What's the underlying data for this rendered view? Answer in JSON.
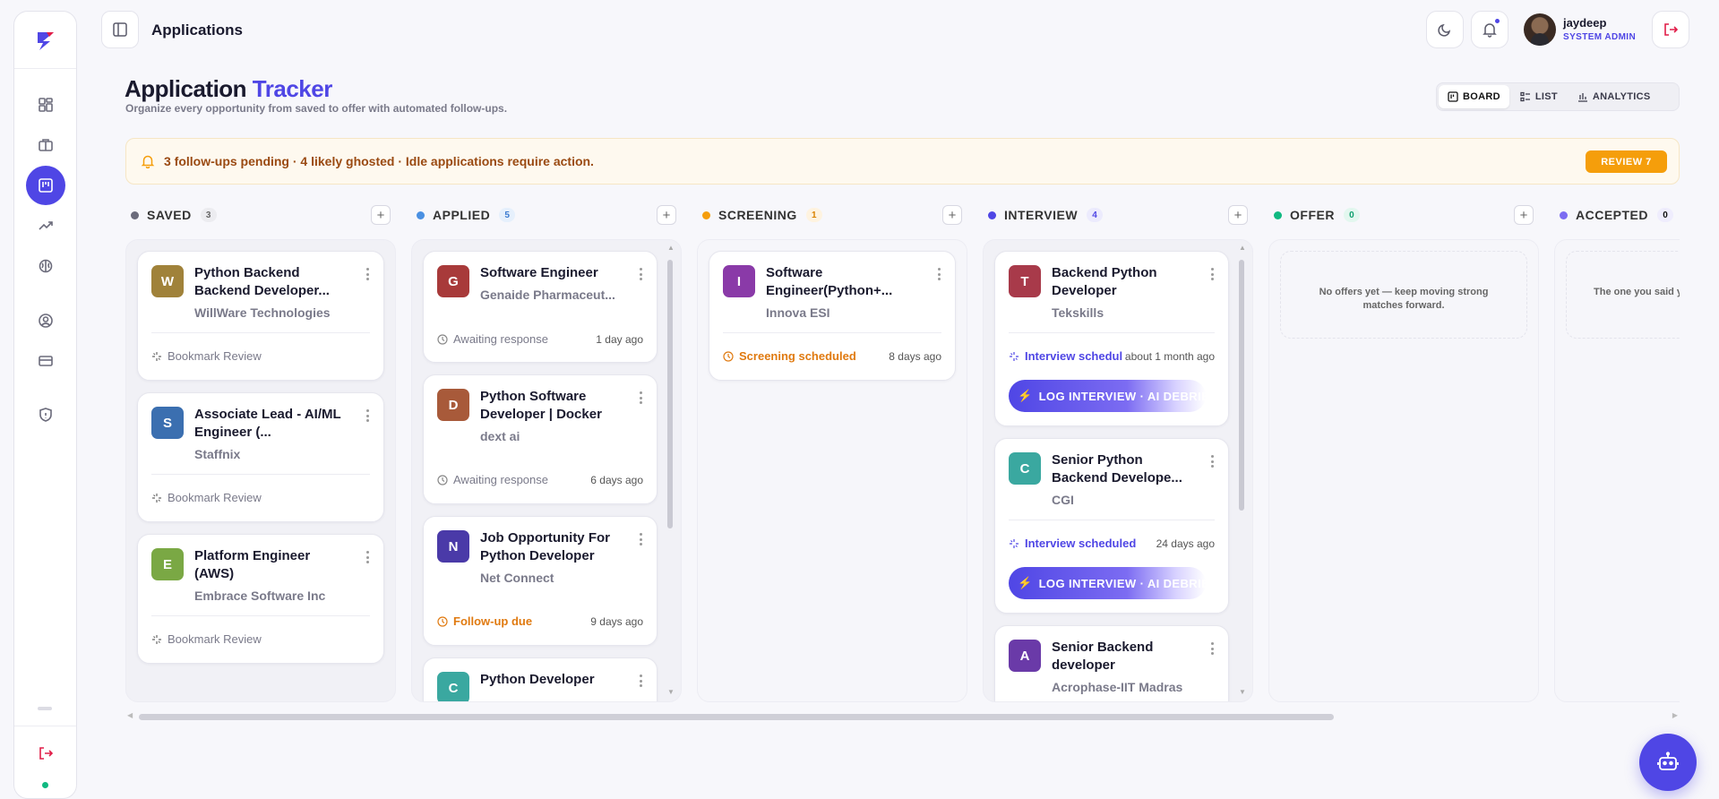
{
  "header": {
    "page_title": "Applications"
  },
  "user": {
    "name": "jaydeep",
    "role": "SYSTEM ADMIN"
  },
  "page": {
    "title_part1": "Application",
    "title_part2": "Tracker",
    "subtitle": "Organize every opportunity from saved to offer with automated follow-ups."
  },
  "views": {
    "board": "BOARD",
    "list": "LIST",
    "analytics": "ANALYTICS",
    "active": "BOARD"
  },
  "alert": {
    "text": "3 follow-ups pending · 4 likely ghosted · Idle applications require action.",
    "button": "REVIEW 7"
  },
  "sidebar": {
    "items": [
      "dashboard-icon",
      "briefcase-icon",
      "kanban-icon",
      "trending-icon",
      "brain-icon",
      "user-circle-icon",
      "credit-card-icon",
      "shield-icon"
    ],
    "active": "kanban-icon"
  },
  "columns": [
    {
      "name": "SAVED",
      "count": "3",
      "color": "#6b6b7b",
      "cards": [
        {
          "initial": "W",
          "color": "#a0823a",
          "role": "Python Backend Backend Developer...",
          "company": "WillWare Technologies",
          "status": "Bookmark Review",
          "when": ""
        },
        {
          "initial": "S",
          "color": "#3b6fb0",
          "role": "Associate Lead - AI/ML Engineer (...",
          "company": "Staffnix",
          "status": "Bookmark Review",
          "when": ""
        },
        {
          "initial": "E",
          "color": "#7aa844",
          "role": "Platform Engineer (AWS)",
          "company": "Embrace Software Inc",
          "status": "Bookmark Review",
          "when": ""
        }
      ]
    },
    {
      "name": "APPLIED",
      "count": "5",
      "color": "#4a90e2",
      "cards": [
        {
          "initial": "G",
          "color": "#a83a3a",
          "role": "Software Engineer",
          "company": "Genaide Pharmaceut...",
          "status": "Awaiting response",
          "when": "1 day ago"
        },
        {
          "initial": "D",
          "color": "#a85a3a",
          "role": "Python Software Developer | Docker",
          "company": "dext ai",
          "status": "Awaiting response",
          "when": "6 days ago"
        },
        {
          "initial": "N",
          "color": "#4a3aa8",
          "role": "Job Opportunity For Python Developer",
          "company": "Net Connect",
          "status": "Follow-up due",
          "when": "9 days ago"
        },
        {
          "initial": "C",
          "color": "#3aa8a0",
          "role": "Python Developer",
          "company": "",
          "status": "",
          "when": ""
        }
      ]
    },
    {
      "name": "SCREENING",
      "count": "1",
      "color": "#f59e0b",
      "cards": [
        {
          "initial": "I",
          "color": "#8a3aa8",
          "role": "Software Engineer(Python+...",
          "company": "Innova ESI",
          "status": "Screening scheduled",
          "when": "8 days ago"
        }
      ]
    },
    {
      "name": "INTERVIEW",
      "count": "4",
      "color": "#4f46e5",
      "cards": [
        {
          "initial": "T",
          "color": "#a83a4a",
          "role": "Backend Python Developer",
          "company": "Tekskills",
          "status": "Interview schedul",
          "when": "about 1 month ago",
          "action": "LOG INTERVIEW · AI DEBRIEF"
        },
        {
          "initial": "C",
          "color": "#3aa8a0",
          "role": "Senior Python Backend Develope...",
          "company": "CGI",
          "status": "Interview scheduled",
          "when": "24 days ago",
          "action": "LOG INTERVIEW · AI DEBRIEF"
        },
        {
          "initial": "A",
          "color": "#6a3aa8",
          "role": "Senior Backend developer",
          "company": "Acrophase-IIT Madras",
          "status": "",
          "when": ""
        }
      ]
    },
    {
      "name": "OFFER",
      "count": "0",
      "color": "#10b981",
      "empty": "No offers yet — keep moving strong matches forward."
    },
    {
      "name": "ACCEPTED",
      "count": "0",
      "color": "#7c6cf2",
      "empty": "The one you said yes"
    }
  ],
  "colors": {
    "accent": "#4f46e5",
    "warning": "#f59e0b",
    "danger": "#e11d48"
  }
}
